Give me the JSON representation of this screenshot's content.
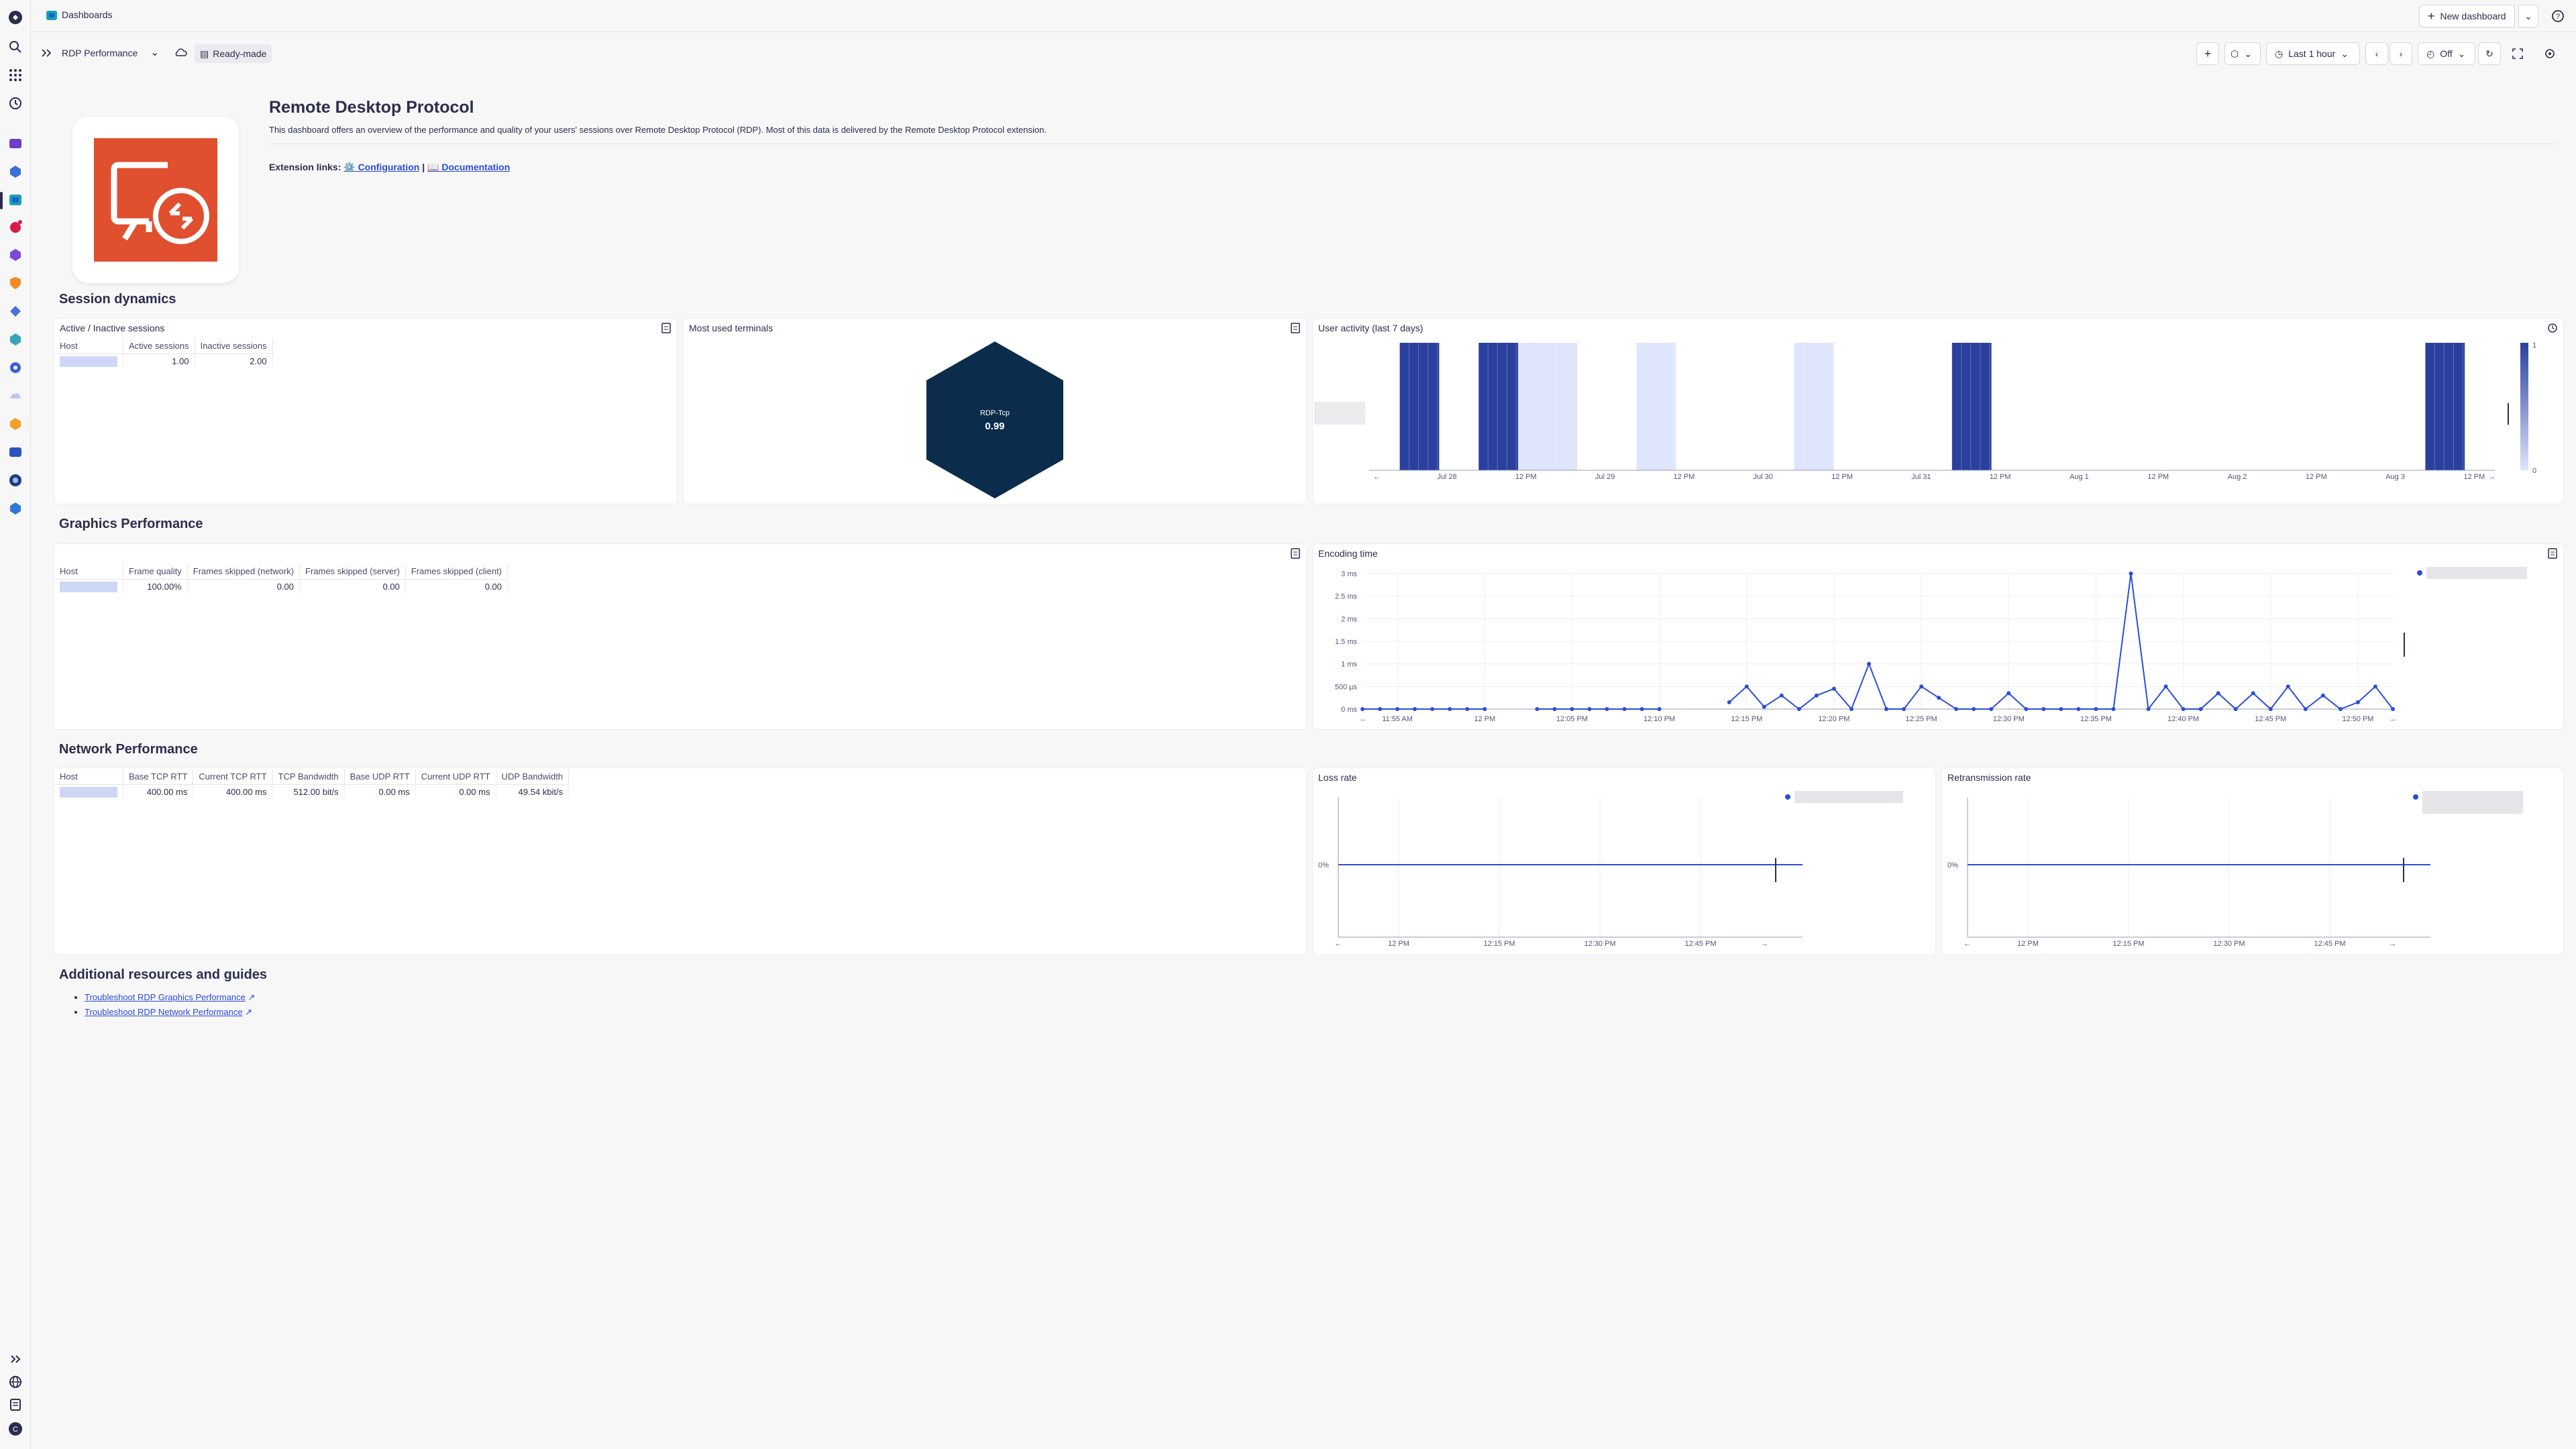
{
  "app": {
    "section_title": "Dashboards",
    "new_dashboard_label": "New dashboard"
  },
  "toolbar": {
    "dashboard_name": "RDP Performance",
    "ready_made_label": "Ready-made",
    "timeframe_label": "Last 1 hour",
    "refresh_label": "Off"
  },
  "header": {
    "title": "Remote Desktop Protocol",
    "description": "This dashboard offers an overview of the performance and quality of your users' sessions over Remote Desktop Protocol (RDP). Most of this data is delivered by the Remote Desktop Protocol extension.",
    "links_label": "Extension links:",
    "config_link": "⚙️ Configuration",
    "separator": "|",
    "docs_link": "📖 Documentation",
    "logo_color": "#e04f2e"
  },
  "sections": {
    "session": "Session dynamics",
    "graphics": "Graphics Performance",
    "network": "Network Performance",
    "resources": "Additional resources and guides"
  },
  "sessions_table": {
    "title": "Active / Inactive sessions",
    "headers": [
      "Host",
      "Active sessions",
      "Inactive sessions"
    ],
    "row": {
      "active": "1.00",
      "inactive": "2.00"
    }
  },
  "terminals": {
    "title": "Most used terminals",
    "label": "RDP-Tcp",
    "value": "0.99",
    "color": "#0b2d4b"
  },
  "user_activity": {
    "title": "User activity (last 7 days)",
    "x_ticks": [
      "Jul 28",
      "12 PM",
      "Jul 29",
      "12 PM",
      "Jul 30",
      "12 PM",
      "Jul 31",
      "12 PM",
      "Aug 1",
      "12 PM",
      "Aug 2",
      "12 PM",
      "Aug 3",
      "12 PM"
    ],
    "legend_max": "1",
    "legend_min": "0",
    "colors": {
      "high": "#2a3f9e",
      "low": "#dfe5fb"
    }
  },
  "graphics_table": {
    "headers": [
      "Host",
      "Frame quality",
      "Frames skipped (network)",
      "Frames skipped (server)",
      "Frames skipped (client)"
    ],
    "row": {
      "frame_quality": "100.00%",
      "skipped_network": "0.00",
      "skipped_server": "0.00",
      "skipped_client": "0.00"
    }
  },
  "encoding_time": {
    "title": "Encoding time",
    "y_ticks": [
      "3 ms",
      "2.5 ms",
      "2 ms",
      "1.5 ms",
      "1 ms",
      "500 µs",
      "0 ms"
    ],
    "x_ticks": [
      "11:55 AM",
      "12 PM",
      "12:05 PM",
      "12:10 PM",
      "12:15 PM",
      "12:20 PM",
      "12:25 PM",
      "12:30 PM",
      "12:35 PM",
      "12:40 PM",
      "12:45 PM",
      "12:50 PM"
    ]
  },
  "network_table": {
    "headers": [
      "Host",
      "Base TCP RTT",
      "Current TCP RTT",
      "TCP Bandwidth",
      "Base UDP RTT",
      "Current UDP RTT",
      "UDP Bandwidth"
    ],
    "row": {
      "base_tcp": "400.00 ms",
      "current_tcp": "400.00 ms",
      "tcp_bw": "512.00 bit/s",
      "base_udp": "0.00 ms",
      "current_udp": "0.00 ms",
      "udp_bw": "49.54 kbit/s"
    }
  },
  "loss_rate": {
    "title": "Loss rate",
    "y_label": "0%",
    "x_ticks": [
      "12 PM",
      "12:15 PM",
      "12:30 PM",
      "12:45 PM"
    ]
  },
  "retransmission_rate": {
    "title": "Retransmission rate",
    "y_label": "0%",
    "x_ticks": [
      "12 PM",
      "12:15 PM",
      "12:30 PM",
      "12:45 PM"
    ]
  },
  "resources": {
    "links": [
      "Troubleshoot RDP Graphics Performance",
      "Troubleshoot RDP Network Performance"
    ]
  },
  "chart_data": [
    {
      "type": "heatmap",
      "title": "User activity (last 7 days)",
      "x_range": [
        "Jul 28",
        "Aug 3"
      ],
      "cells": [
        {
          "start": "Jul 27 18:00",
          "end": "Jul 28 00:00",
          "level": "high"
        },
        {
          "start": "Jul 28 06:00",
          "end": "Jul 28 12:00",
          "level": "high"
        },
        {
          "start": "Jul 28 12:00",
          "end": "Jul 28 21:00",
          "level": "low"
        },
        {
          "start": "Jul 29 06:00",
          "end": "Jul 29 12:00",
          "level": "low"
        },
        {
          "start": "Jul 30 06:00",
          "end": "Jul 30 12:00",
          "level": "low"
        },
        {
          "start": "Jul 31 06:00",
          "end": "Jul 31 12:00",
          "level": "high"
        },
        {
          "start": "Aug 3 06:00",
          "end": "Aug 3 12:00",
          "level": "high"
        }
      ]
    },
    {
      "type": "line",
      "title": "Encoding time",
      "ylabel": "ms",
      "ylim": [
        0,
        3
      ],
      "x": [
        "11:53",
        "11:54",
        "11:55",
        "11:56",
        "11:57",
        "11:58",
        "11:59",
        "12:00",
        "12:01",
        "12:02",
        "12:03",
        "12:04",
        "12:05",
        "12:06",
        "12:07",
        "12:08",
        "12:09",
        "12:10",
        "12:11",
        "12:12",
        "12:13",
        "12:14",
        "12:15",
        "12:16",
        "12:17",
        "12:18",
        "12:19",
        "12:20",
        "12:21",
        "12:22",
        "12:23",
        "12:24",
        "12:25",
        "12:26",
        "12:27",
        "12:28",
        "12:29",
        "12:30",
        "12:31",
        "12:32",
        "12:33",
        "12:34",
        "12:35",
        "12:36",
        "12:37",
        "12:38",
        "12:39",
        "12:40",
        "12:41",
        "12:42",
        "12:43",
        "12:44",
        "12:45",
        "12:46",
        "12:47",
        "12:48",
        "12:49",
        "12:50",
        "12:51",
        "12:52"
      ],
      "values": [
        0,
        0,
        0,
        0,
        0,
        0,
        0,
        0,
        null,
        null,
        0,
        0,
        0,
        0,
        0,
        0,
        0,
        0,
        null,
        null,
        null,
        0.15,
        0.5,
        0.05,
        0.3,
        0,
        0.3,
        0.45,
        0,
        1.0,
        0,
        0,
        0.5,
        0.25,
        0,
        0,
        0,
        0.35,
        0,
        0,
        0,
        0,
        0,
        0,
        3.0,
        0,
        0.5,
        0,
        0,
        0.35,
        0,
        0.35,
        0,
        0.5,
        0,
        0.3,
        0,
        0.15,
        0.5,
        0
      ]
    },
    {
      "type": "line",
      "title": "Loss rate",
      "x_range": [
        "11:52",
        "12:52"
      ],
      "values": [
        0,
        0
      ],
      "ylabel": "0%"
    },
    {
      "type": "line",
      "title": "Retransmission rate",
      "x_range": [
        "11:52",
        "12:52"
      ],
      "values": [
        0,
        0
      ],
      "ylabel": "0%"
    }
  ]
}
